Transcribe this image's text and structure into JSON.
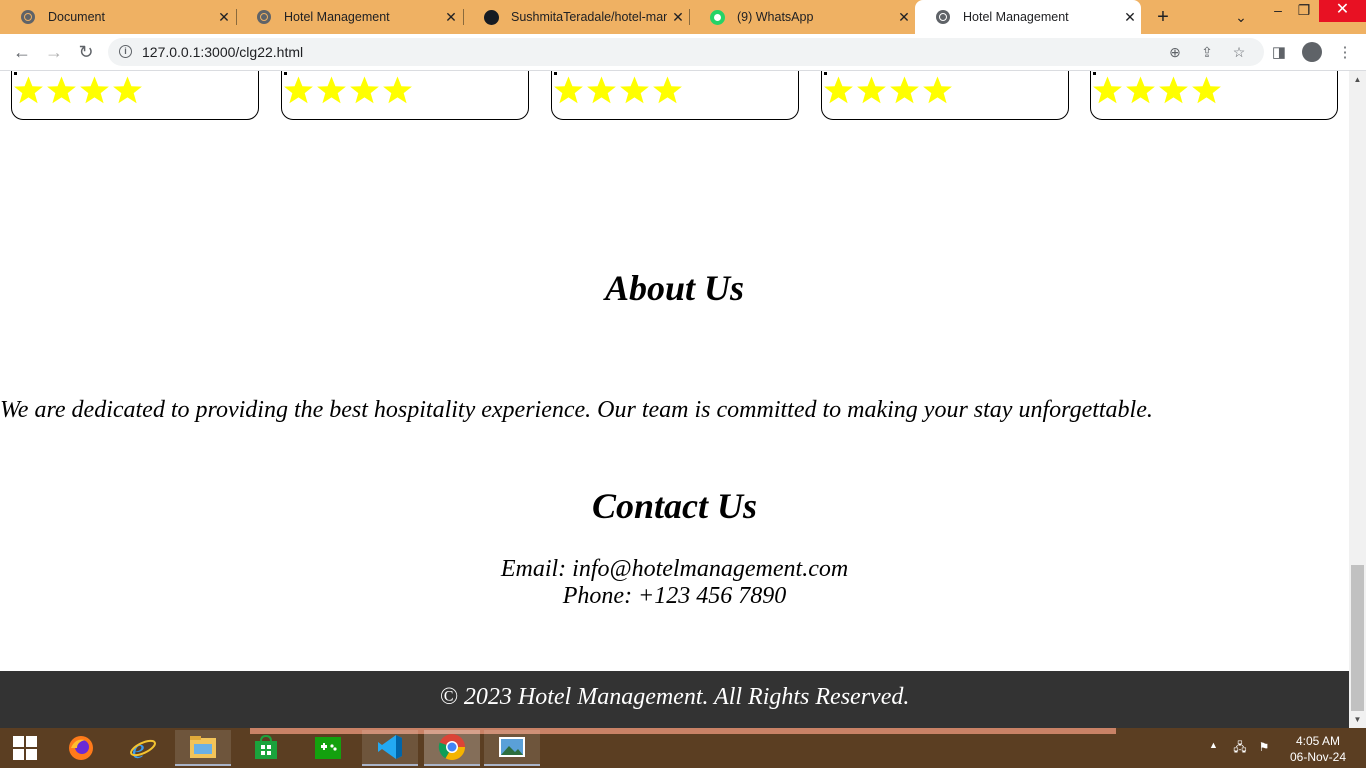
{
  "browser": {
    "tabs": [
      {
        "title": "Document",
        "icon": "globe-icon",
        "active": false
      },
      {
        "title": "Hotel Management",
        "icon": "globe-icon",
        "active": false
      },
      {
        "title": "SushmitaTeradale/hotel-management",
        "icon": "github-icon",
        "active": false
      },
      {
        "title": "(9) WhatsApp",
        "icon": "whatsapp-icon",
        "active": false
      },
      {
        "title": "Hotel Management",
        "icon": "globe-icon",
        "active": true
      }
    ],
    "url": "127.0.0.1:3000/clg22.html"
  },
  "page": {
    "rating_cards": [
      {
        "stars": 4
      },
      {
        "stars": 4
      },
      {
        "stars": 4
      },
      {
        "stars": 4
      },
      {
        "stars": 4
      }
    ],
    "star_color": "#ffff00",
    "about": {
      "title": "About Us",
      "text": "We are dedicated to providing the best hospitality experience. Our team is committed to making your stay unforgettable."
    },
    "contact": {
      "title": "Contact Us",
      "email": "Email: info@hotelmanagement.com",
      "phone": "Phone: +123 456 7890"
    },
    "footer": {
      "text": "© 2023 Hotel Management. All Rights Reserved.",
      "background": "#333333"
    }
  },
  "taskbar": {
    "apps": [
      "firefox-icon",
      "internet-explorer-icon",
      "file-explorer-icon",
      "store-icon",
      "xbox-icon",
      "vscode-icon",
      "chrome-icon",
      "photos-icon"
    ],
    "time": "4:05 AM",
    "date": "06-Nov-24"
  }
}
